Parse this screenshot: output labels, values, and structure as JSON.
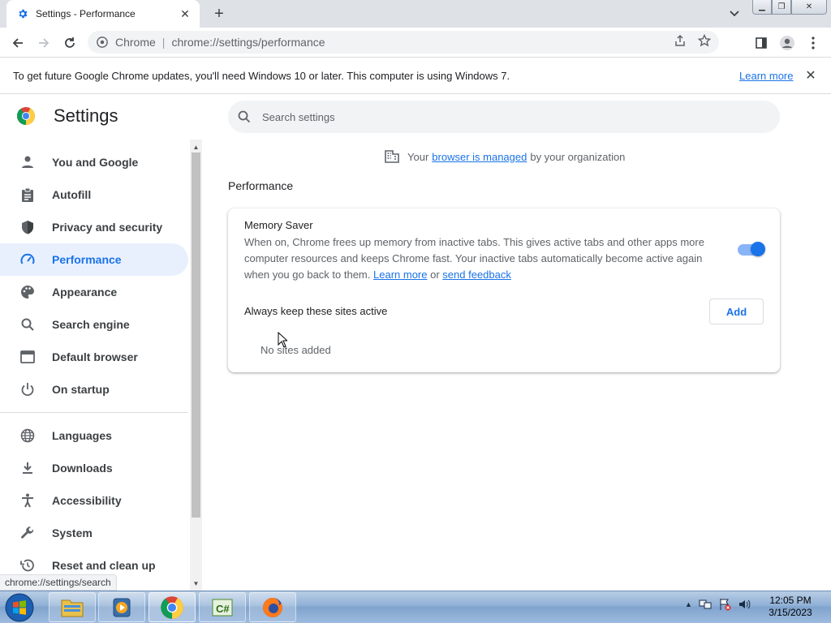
{
  "browser": {
    "tab_title": "Settings - Performance",
    "omnibox_scheme": "Chrome",
    "omnibox_url": "chrome://settings/performance"
  },
  "infobar": {
    "message": "To get future Google Chrome updates, you'll need Windows 10 or later. This computer is using Windows 7.",
    "learn_more": "Learn more"
  },
  "settings": {
    "title": "Settings",
    "search_placeholder": "Search settings",
    "managed": {
      "prefix": "Your",
      "link": "browser is managed",
      "suffix": "by your organization"
    },
    "nav": [
      {
        "label": "You and Google",
        "icon": "person-icon"
      },
      {
        "label": "Autofill",
        "icon": "clipboard-icon"
      },
      {
        "label": "Privacy and security",
        "icon": "shield-icon"
      },
      {
        "label": "Performance",
        "icon": "speedometer-icon",
        "active": true
      },
      {
        "label": "Appearance",
        "icon": "palette-icon"
      },
      {
        "label": "Search engine",
        "icon": "search-icon"
      },
      {
        "label": "Default browser",
        "icon": "browser-window-icon"
      },
      {
        "label": "On startup",
        "icon": "power-icon"
      },
      {
        "label": "Languages",
        "icon": "globe-icon"
      },
      {
        "label": "Downloads",
        "icon": "download-icon"
      },
      {
        "label": "Accessibility",
        "icon": "accessibility-icon"
      },
      {
        "label": "System",
        "icon": "wrench-icon"
      },
      {
        "label": "Reset and clean up",
        "icon": "history-icon"
      }
    ]
  },
  "performance": {
    "section_title": "Performance",
    "memory_saver": {
      "title": "Memory Saver",
      "description": "When on, Chrome frees up memory from inactive tabs. This gives active tabs and other apps more computer resources and keeps Chrome fast. Your inactive tabs automatically become active again when you go back to them.",
      "learn_more": "Learn more",
      "or": "or",
      "send_feedback": "send feedback",
      "enabled": true
    },
    "keep_active": {
      "label": "Always keep these sites active",
      "add_button": "Add",
      "empty_text": "No sites added"
    }
  },
  "status_url": "chrome://settings/search",
  "taskbar": {
    "time": "12:05 PM",
    "date": "3/15/2023"
  },
  "colors": {
    "accent": "#1a73e8",
    "active_nav_bg": "#e8f0fe"
  }
}
